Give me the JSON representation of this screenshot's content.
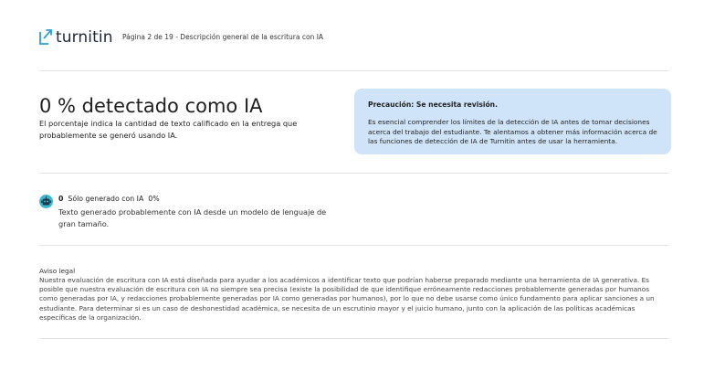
{
  "header": {
    "logo_text": "turnitin",
    "page_info": "Página 2 de 19 - Descripción general de la escritura con IA"
  },
  "summary": {
    "headline": "0 % detectado como IA",
    "description": "El porcentaje indica la cantidad de texto calificado en la entrega que probablemente se generó usando IA."
  },
  "caution": {
    "title": "Precaución: Se necesita revisión.",
    "body": "Es esencial comprender los límites de la detección de IA antes de tomar decisiones acerca del trabajo del estudiante. Te alentamos a obtener más información acerca de las funciones de detección de IA de Turnitin antes de usar la herramienta."
  },
  "category": {
    "icon": "robot-icon",
    "count": "0",
    "label": "Sólo generado con IA",
    "percent": "0%",
    "description": "Texto generado probablemente con IA desde un modelo de lenguaje de gran tamaño."
  },
  "legal": {
    "title": "Aviso legal",
    "body": "Nuestra evaluación de escritura con IA está diseñada para ayudar a los académicos a identificar texto que podrían haberse preparado mediante una herramienta de IA generativa. Es posible que nuestra evaluación de escritura con IA no siempre sea precisa (existe la posibilidad de que identifique erróneamente redacciones probablemente generadas por humanos como generadas por IA, y redacciones probablemente generadas por IA como generadas por humanos), por lo que no debe usarse como único fundamento para aplicar sanciones a un estudiante. Para determinar si es un caso de deshonestidad académica, se necesita de un escrutinio mayor y el juicio humano, junto con la aplicación de las políticas académicas específicas de la organización."
  },
  "colors": {
    "caution_bg": "#cfe4f9",
    "robot_icon": "#3ab6d0",
    "logo_mark": "#2a9fd6"
  }
}
